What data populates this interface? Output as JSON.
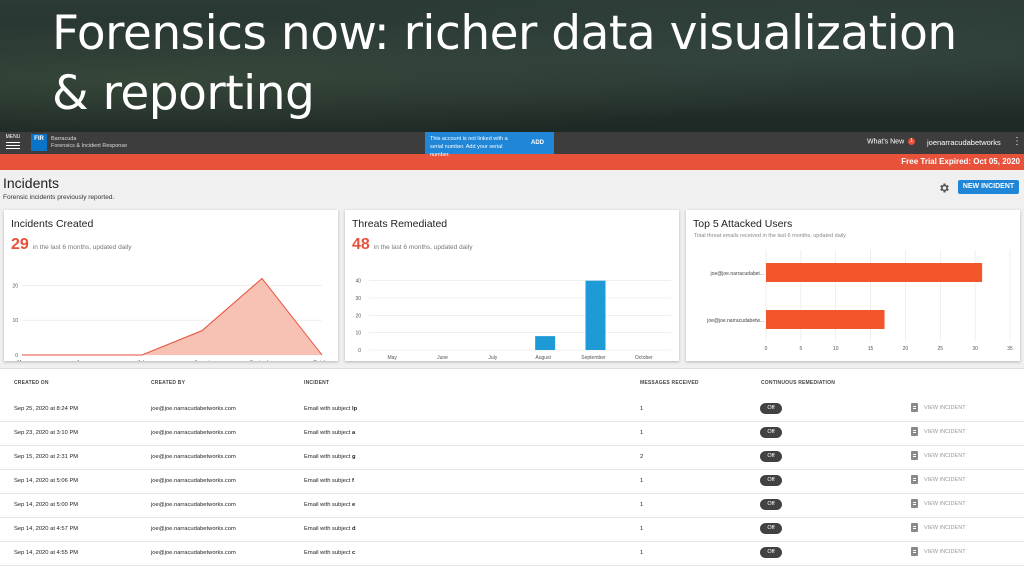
{
  "slide": {
    "title": "Forensics now: richer data visualization & reporting"
  },
  "topbar": {
    "menu_label": "MENU",
    "logo_text": "FIR",
    "brand_line1": "Barracuda",
    "brand_line2": "Forensics & Incident Response",
    "serial_message": "This account is not linked with a serial number. Add your serial number.",
    "add_label": "ADD",
    "whats_new_label": "What's New",
    "whats_new_count": "1",
    "user_name": "joenarracudabetworks",
    "kebab": "⋮"
  },
  "trial_banner": "Free Trial Expired: Oct 05, 2020",
  "page": {
    "title": "Incidents",
    "subtitle": "Forensic incidents previously reported.",
    "new_incident_label": "NEW INCIDENT"
  },
  "cards": {
    "incidents": {
      "title": "Incidents Created",
      "value": "29",
      "caption": "in the last 6 months, updated daily"
    },
    "threats": {
      "title": "Threats Remediated",
      "value": "48",
      "caption": "in the last 6 months, updated daily"
    },
    "users": {
      "title": "Top 5 Attacked Users",
      "caption": "Total threat emails received in the last 6 months, updated daily"
    }
  },
  "chart_data": [
    {
      "type": "area",
      "title": "Incidents Created",
      "categories": [
        "May",
        "June",
        "July",
        "August",
        "September",
        "October"
      ],
      "values": [
        0,
        0,
        0,
        7,
        22,
        0
      ],
      "yticks": [
        0,
        10,
        20
      ],
      "ylim": [
        0,
        25
      ],
      "color": "#e8513a"
    },
    {
      "type": "bar",
      "title": "Threats Remediated",
      "categories": [
        "May",
        "June",
        "July",
        "August",
        "September",
        "October"
      ],
      "values": [
        0,
        0,
        0,
        8,
        40,
        0
      ],
      "yticks": [
        0,
        10,
        20,
        30,
        40
      ],
      "ylim": [
        0,
        45
      ],
      "color": "#1e9ad6"
    },
    {
      "type": "bar",
      "orientation": "horizontal",
      "title": "Top 5 Attacked Users",
      "categories": [
        "joe@joe.narracudabet...",
        "joe@joe.narracudabetw..."
      ],
      "values": [
        31,
        17
      ],
      "xticks": [
        0,
        5,
        10,
        15,
        20,
        25,
        30,
        35
      ],
      "xlim": [
        0,
        35
      ],
      "color": "#f4562c"
    }
  ],
  "table": {
    "headers": [
      "CREATED ON",
      "CREATED BY",
      "INCIDENT",
      "MESSAGES RECEIVED",
      "CONTINUOUS REMEDIATION"
    ],
    "view_label": "VIEW INCIDENT",
    "toggle_label": "Off",
    "incident_prefix": "Email with subject",
    "rows": [
      {
        "created_on": "Sep 25, 2020 at 8:24 PM",
        "created_by": "joe@joe.narracudabetworks.com",
        "subject": "lp",
        "messages": "1"
      },
      {
        "created_on": "Sep 23, 2020 at 3:10 PM",
        "created_by": "joe@joe.narracudabetworks.com",
        "subject": "a",
        "messages": "1"
      },
      {
        "created_on": "Sep 15, 2020 at 2:31 PM",
        "created_by": "joe@joe.narracudabetworks.com",
        "subject": "g",
        "messages": "2"
      },
      {
        "created_on": "Sep 14, 2020 at 5:06 PM",
        "created_by": "joe@joe.narracudabetworks.com",
        "subject": "f",
        "messages": "1"
      },
      {
        "created_on": "Sep 14, 2020 at 5:00 PM",
        "created_by": "joe@joe.narracudabetworks.com",
        "subject": "e",
        "messages": "1"
      },
      {
        "created_on": "Sep 14, 2020 at 4:57 PM",
        "created_by": "joe@joe.narracudabetworks.com",
        "subject": "d",
        "messages": "1"
      },
      {
        "created_on": "Sep 14, 2020 at 4:55 PM",
        "created_by": "joe@joe.narracudabetworks.com",
        "subject": "c",
        "messages": "1"
      }
    ]
  }
}
